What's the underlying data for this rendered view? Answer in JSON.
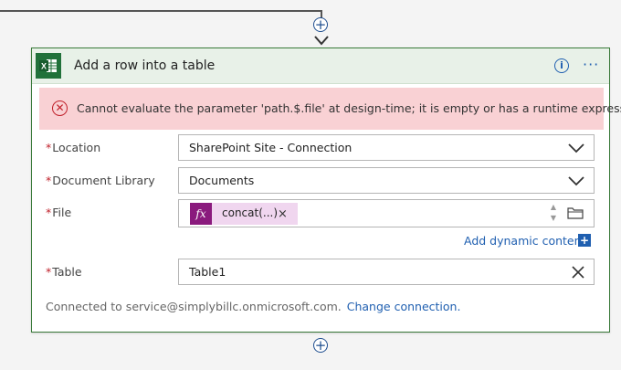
{
  "connectors": {
    "top_plus": "+",
    "bottom_plus": "+"
  },
  "action": {
    "title": "Add a row into a table",
    "icon": "excel-icon",
    "header_color": "#e8f1e8",
    "border_color": "#3a7a3a"
  },
  "error": {
    "message": "Cannot evaluate the parameter 'path.$.file' at design-time; it is empty or has a runtime expression.",
    "color": "#c0202a",
    "background": "#f9d1d4"
  },
  "fields": {
    "required_mark": "*",
    "location": {
      "label": "Location",
      "value": "SharePoint Site - Connection"
    },
    "document_library": {
      "label": "Document Library",
      "value": "Documents"
    },
    "file": {
      "label": "File",
      "token_label": "concat(...)",
      "token_remove": "×",
      "token_icon": "fx"
    },
    "table": {
      "label": "Table",
      "value": "Table1"
    }
  },
  "dynamic_content": {
    "label": "Add dynamic content",
    "plus": "+"
  },
  "footer": {
    "connected_text": "Connected to service@simplybillc.onmicrosoft.com.",
    "change_link": "Change connection."
  }
}
